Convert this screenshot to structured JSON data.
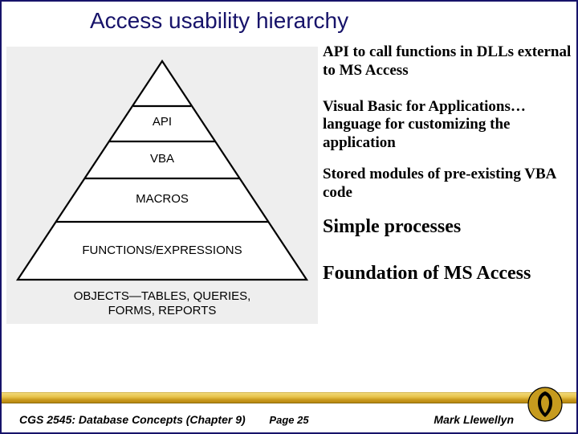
{
  "title": "Access usability hierarchy",
  "pyramid": {
    "levels": [
      "API",
      "VBA",
      "MACROS",
      "FUNCTIONS/EXPRESSIONS"
    ],
    "base": "OBJECTS—TABLES, QUERIES, FORMS, REPORTS"
  },
  "annotations": {
    "a1": "API to call functions in DLLs external to MS Access",
    "a2": "Visual Basic for Applications…language for customizing the application",
    "a3": "Stored modules of pre-existing VBA code",
    "a4": "Simple processes",
    "a5": "Foundation of MS Access"
  },
  "footer": {
    "left": "CGS 2545: Database Concepts  (Chapter 9)",
    "page": "Page 25",
    "right": "Mark Llewellyn"
  },
  "chart_data": {
    "type": "pyramid",
    "title": "Access usability hierarchy",
    "levels_top_to_bottom": [
      {
        "label": "API",
        "description": "API to call functions in DLLs external to MS Access"
      },
      {
        "label": "VBA",
        "description": "Visual Basic for Applications…language for customizing the application"
      },
      {
        "label": "MACROS",
        "description": "Stored modules of pre-existing VBA code"
      },
      {
        "label": "FUNCTIONS/EXPRESSIONS",
        "description": "Simple processes"
      },
      {
        "label": "OBJECTS—TABLES, QUERIES, FORMS, REPORTS",
        "description": "Foundation of MS Access"
      }
    ]
  }
}
